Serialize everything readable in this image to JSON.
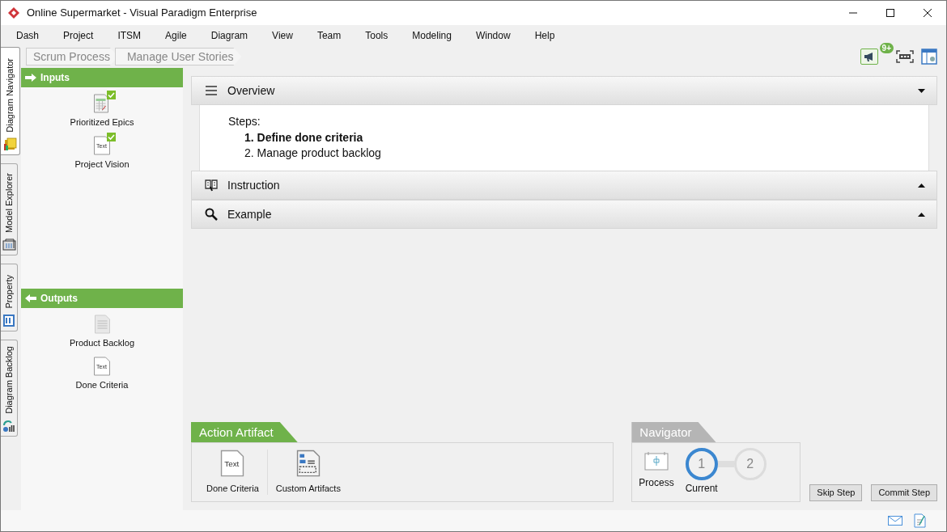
{
  "window": {
    "title": "Online Supermarket - Visual Paradigm Enterprise"
  },
  "menu": [
    "Dash",
    "Project",
    "ITSM",
    "Agile",
    "Diagram",
    "View",
    "Team",
    "Tools",
    "Modeling",
    "Window",
    "Help"
  ],
  "side_tabs": [
    {
      "label": "Diagram Navigator",
      "selected": true
    },
    {
      "label": "Model Explorer",
      "selected": false
    },
    {
      "label": "Property",
      "selected": false
    },
    {
      "label": "Diagram Backlog",
      "selected": false
    }
  ],
  "breadcrumb": [
    "Scrum Process",
    "Manage User Stories"
  ],
  "toolbar": {
    "notification_badge": "9+"
  },
  "inputs": {
    "title": "Inputs",
    "items": [
      {
        "label": "Prioritized Epics",
        "kind": "table",
        "checked": true
      },
      {
        "label": "Project Vision",
        "kind": "text",
        "icon_text": "Text",
        "checked": true
      }
    ]
  },
  "outputs": {
    "title": "Outputs",
    "items": [
      {
        "label": "Product Backlog",
        "kind": "document",
        "checked": false
      },
      {
        "label": "Done Criteria",
        "kind": "text",
        "icon_text": "Text",
        "checked": false
      }
    ]
  },
  "sections": [
    {
      "title": "Overview",
      "expanded": true
    },
    {
      "title": "Instruction",
      "expanded": false
    },
    {
      "title": "Example",
      "expanded": false
    }
  ],
  "overview": {
    "heading": "Steps:",
    "steps": [
      {
        "number": "1.",
        "text": "Define done criteria",
        "current": true
      },
      {
        "number": "2.",
        "text": "Manage product backlog",
        "current": false
      }
    ]
  },
  "action_artifact": {
    "title": "Action Artifact",
    "items": [
      {
        "label": "Done Criteria",
        "kind": "text",
        "icon_text": "Text"
      },
      {
        "label": "Custom Artifacts",
        "kind": "form"
      }
    ]
  },
  "navigator": {
    "title": "Navigator",
    "process_label": "Process",
    "steps": [
      {
        "number": "1",
        "label": "Current",
        "selected": true
      },
      {
        "number": "2",
        "selected": false
      }
    ]
  },
  "buttons": [
    "Skip Step",
    "Commit Step"
  ]
}
